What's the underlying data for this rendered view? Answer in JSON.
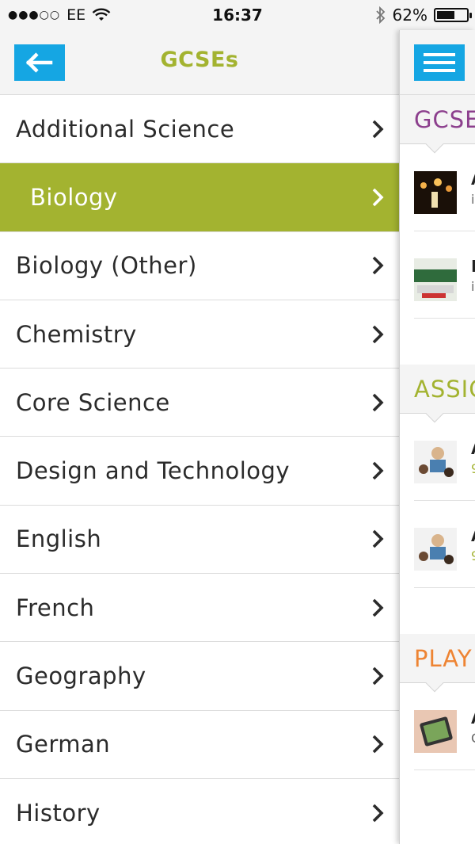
{
  "status": {
    "carrier": "EE",
    "time": "16:37",
    "battery": "62%",
    "battery_level": 0.62
  },
  "menu": {
    "title": "GCSEs",
    "items": [
      {
        "label": "Additional Science",
        "active": false
      },
      {
        "label": "Biology",
        "active": true
      },
      {
        "label": "Biology (Other)",
        "active": false
      },
      {
        "label": "Chemistry",
        "active": false
      },
      {
        "label": "Core Science",
        "active": false
      },
      {
        "label": "Design and Technology",
        "active": false
      },
      {
        "label": "English",
        "active": false
      },
      {
        "label": "French",
        "active": false
      },
      {
        "label": "Geography",
        "active": false
      },
      {
        "label": "German",
        "active": false
      },
      {
        "label": "History",
        "active": false
      }
    ]
  },
  "content": {
    "sections": [
      {
        "title": "GCSE",
        "color": "#8c3f8d",
        "rows": [
          {
            "letter": "A",
            "sub": "i"
          },
          {
            "letter": "B",
            "sub": "i"
          }
        ]
      },
      {
        "title": "ASSIG",
        "color": "#a3b330",
        "rows": [
          {
            "letter": "A",
            "sub": "9"
          },
          {
            "letter": "A",
            "sub": "9"
          }
        ]
      },
      {
        "title": "PLAY",
        "color": "#ee8433",
        "rows": [
          {
            "letter": "A",
            "sub": "C"
          }
        ]
      }
    ]
  },
  "colors": {
    "accent_blue": "#15a6e3",
    "accent_green": "#a3b330"
  }
}
